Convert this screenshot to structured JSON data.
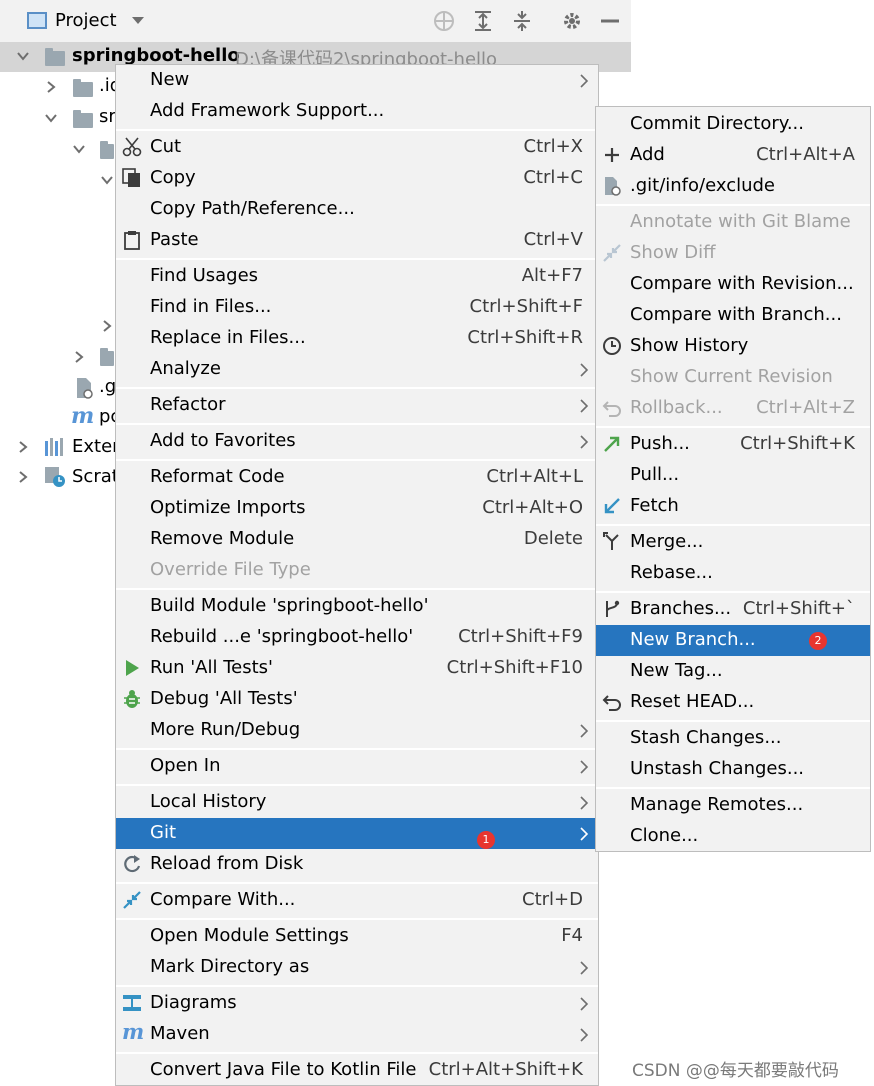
{
  "toolbar": {
    "title": "Project"
  },
  "tree": {
    "root_name": "springboot-hello",
    "root_path": "D:\\备课代码2\\springboot-hello",
    "row_idea": ".id",
    "row_src": "sr",
    "row_git": ".g",
    "row_pom": "pc",
    "external": "Exter",
    "scratches": "Scrat"
  },
  "menu1": {
    "new": "New",
    "add_framework": "Add Framework Support...",
    "cut": "Cut",
    "cut_sc": "Ctrl+X",
    "copy": "Copy",
    "copy_sc": "Ctrl+C",
    "copy_path": "Copy Path/Reference...",
    "paste": "Paste",
    "paste_sc": "Ctrl+V",
    "find_usages": "Find Usages",
    "find_usages_sc": "Alt+F7",
    "find_in_files": "Find in Files...",
    "find_in_files_sc": "Ctrl+Shift+F",
    "replace_in_files": "Replace in Files...",
    "replace_in_files_sc": "Ctrl+Shift+R",
    "analyze": "Analyze",
    "refactor": "Refactor",
    "add_favorites": "Add to Favorites",
    "reformat": "Reformat Code",
    "reformat_sc": "Ctrl+Alt+L",
    "optimize": "Optimize Imports",
    "optimize_sc": "Ctrl+Alt+O",
    "remove_module": "Remove Module",
    "remove_module_sc": "Delete",
    "override": "Override File Type",
    "build_module": "Build Module 'springboot-hello'",
    "rebuild": "Rebuild ...e 'springboot-hello'",
    "rebuild_sc": "Ctrl+Shift+F9",
    "run": "Run 'All Tests'",
    "run_sc": "Ctrl+Shift+F10",
    "debug": "Debug 'All Tests'",
    "more_run": "More Run/Debug",
    "open_in": "Open In",
    "local_history": "Local History",
    "git": "Git",
    "reload": "Reload from Disk",
    "compare_with": "Compare With...",
    "compare_with_sc": "Ctrl+D",
    "module_settings": "Open Module Settings",
    "module_settings_sc": "F4",
    "mark_dir": "Mark Directory as",
    "diagrams": "Diagrams",
    "maven": "Maven",
    "convert": "Convert Java File to Kotlin File",
    "convert_sc": "Ctrl+Alt+Shift+K"
  },
  "menu2": {
    "commit_dir": "Commit Directory...",
    "add": "Add",
    "add_sc": "Ctrl+Alt+A",
    "exclude": ".git/info/exclude",
    "annotate": "Annotate with Git Blame",
    "show_diff": "Show Diff",
    "compare_rev": "Compare with Revision...",
    "compare_branch": "Compare with Branch...",
    "show_history": "Show History",
    "show_current": "Show Current Revision",
    "rollback": "Rollback...",
    "rollback_sc": "Ctrl+Alt+Z",
    "push": "Push...",
    "push_sc": "Ctrl+Shift+K",
    "pull": "Pull...",
    "fetch": "Fetch",
    "merge": "Merge...",
    "rebase": "Rebase...",
    "branches": "Branches...",
    "branches_sc": "Ctrl+Shift+`",
    "new_branch": "New Branch...",
    "new_tag": "New Tag...",
    "reset_head": "Reset HEAD...",
    "stash": "Stash Changes...",
    "unstash": "Unstash Changes...",
    "manage_remotes": "Manage Remotes...",
    "clone": "Clone..."
  },
  "badges": {
    "one": "1",
    "two": "2"
  },
  "watermark": "CSDN @@每天都要敲代码",
  "colors": {
    "selection": "#2675bf",
    "menu_bg": "#f2f2f2",
    "badge": "#e8352f"
  }
}
